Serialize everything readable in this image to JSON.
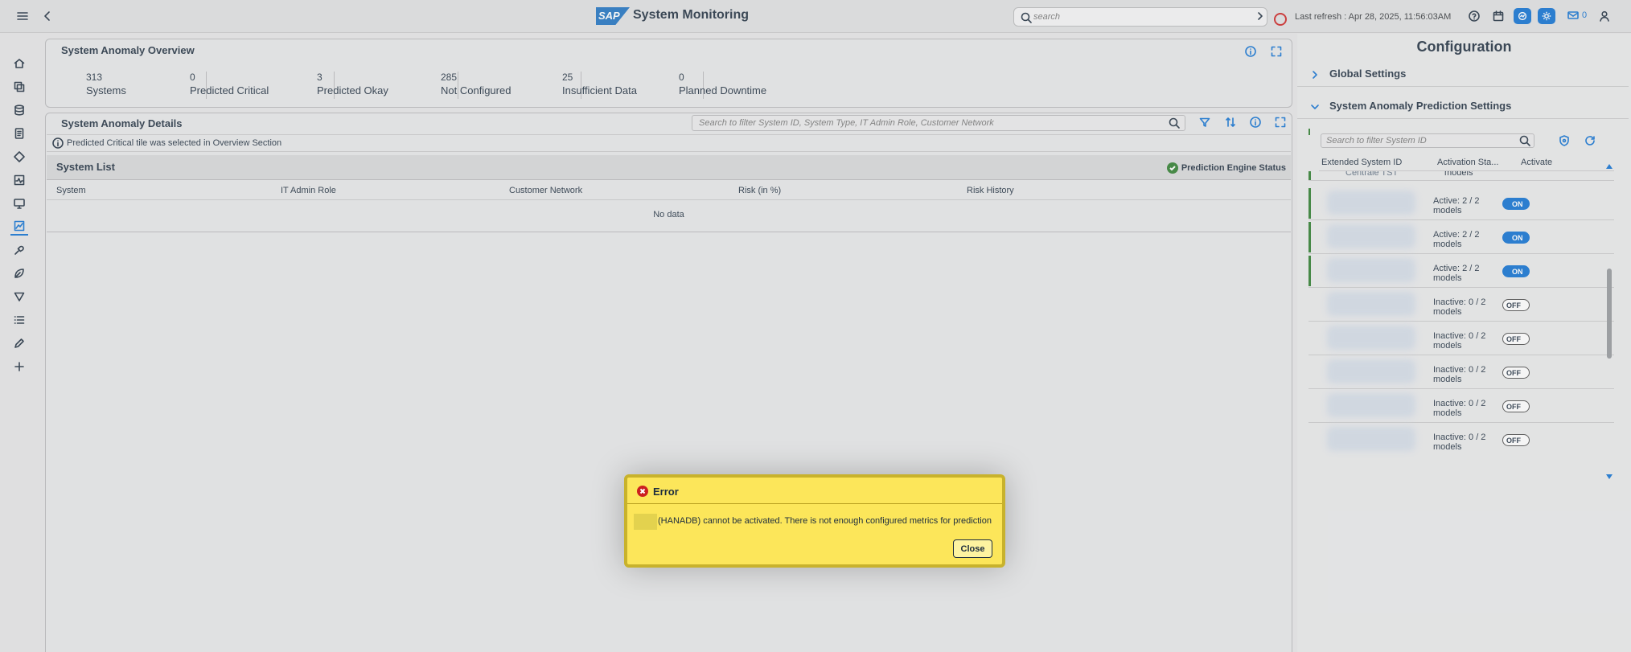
{
  "shell": {
    "logo_text": "SAP",
    "title": "System Monitoring",
    "search_placeholder": "search",
    "last_refresh": "Last refresh : Apr 28, 2025, 11:56:03AM",
    "messages_count": "0"
  },
  "sidebar": {
    "icons": [
      "home-icon",
      "layers-icon",
      "database-icon",
      "document-icon",
      "diamond-icon",
      "activity-chart-icon",
      "monitor-icon",
      "trend-chart-icon",
      "tools-icon",
      "leaf-icon",
      "filter-icon",
      "list-icon",
      "edit-icon",
      "add-icon"
    ],
    "active": "trend-chart-icon"
  },
  "overview": {
    "title": "System Anomaly Overview",
    "kpis": [
      {
        "value": "313",
        "label": "Systems"
      },
      {
        "value": "0",
        "label": "Predicted Critical"
      },
      {
        "value": "3",
        "label": "Predicted Okay"
      },
      {
        "value": "285",
        "label": "Not Configured"
      },
      {
        "value": "25",
        "label": "Insufficient Data"
      },
      {
        "value": "0",
        "label": "Planned Downtime"
      }
    ]
  },
  "details": {
    "title": "System Anomaly Details",
    "search_placeholder": "Search to filter System ID, System Type, IT Admin Role, Customer Network",
    "info_message": "Predicted Critical tile was selected in Overview Section",
    "list_title": "System List",
    "engine_status": "Prediction Engine Status",
    "columns": [
      "System",
      "IT Admin Role",
      "Customer Network",
      "Risk (in %)",
      "Risk History"
    ],
    "empty_text": "No data"
  },
  "config": {
    "title": "Configuration",
    "sections": [
      {
        "label": "Global Settings",
        "expanded": false
      },
      {
        "label": "System Anomaly Prediction Settings",
        "expanded": true
      }
    ],
    "search_placeholder": "Search to filter System ID",
    "columns": [
      "Extended System ID",
      "Activation Sta...",
      "Activate"
    ],
    "partial_row_id": "Centrale TST",
    "partial_row_status": "models",
    "rows": [
      {
        "status_line1": "Active: 2 / 2",
        "status_line2": "models",
        "toggle": "ON",
        "active": true
      },
      {
        "status_line1": "Active: 2 / 2",
        "status_line2": "models",
        "toggle": "ON",
        "active": true
      },
      {
        "status_line1": "Active: 2 / 2",
        "status_line2": "models",
        "toggle": "ON",
        "active": true
      },
      {
        "status_line1": "Inactive: 0 / 2",
        "status_line2": "models",
        "toggle": "OFF",
        "active": false
      },
      {
        "status_line1": "Inactive: 0 / 2",
        "status_line2": "models",
        "toggle": "OFF",
        "active": false
      },
      {
        "status_line1": "Inactive: 0 / 2",
        "status_line2": "models",
        "toggle": "OFF",
        "active": false
      },
      {
        "status_line1": "Inactive: 0 / 2",
        "status_line2": "models",
        "toggle": "OFF",
        "active": false
      },
      {
        "status_line1": "Inactive: 0 / 2",
        "status_line2": "models",
        "toggle": "OFF",
        "active": false
      }
    ]
  },
  "dialog": {
    "title": "Error",
    "message": "(HANADB) cannot be activated. There is not enough configured metrics for prediction",
    "close_label": "Close"
  },
  "colors": {
    "accent": "#0a6ed1",
    "success": "#2b7c2b",
    "error": "#cc1f1f",
    "dialog_bg": "#fce65a"
  }
}
